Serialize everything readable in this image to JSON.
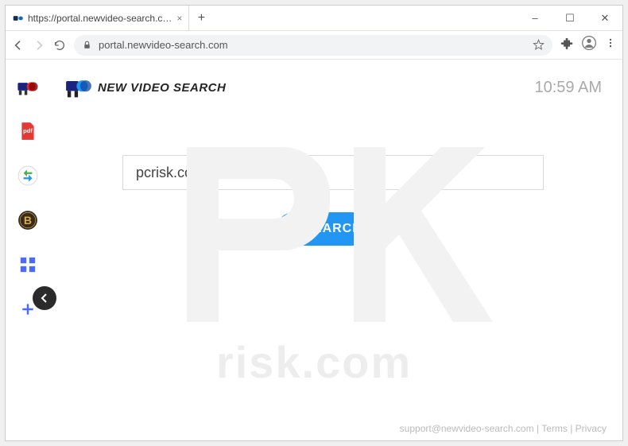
{
  "window": {
    "tab_title": "https://portal.newvideo-search.c…",
    "minimize": "–",
    "maximize": "☐",
    "close": "✕",
    "newtab": "+"
  },
  "toolbar": {
    "url": "portal.newvideo-search.com"
  },
  "header": {
    "brand": "NEW VIDEO SEARCH",
    "time": "10:59 AM"
  },
  "search": {
    "value": "pcrisk.com",
    "button": "SEARCH"
  },
  "sidebar": {
    "items": [
      {
        "name": "camera-icon"
      },
      {
        "name": "pdf-icon"
      },
      {
        "name": "swap-icon"
      },
      {
        "name": "bitcoin-icon"
      },
      {
        "name": "apps-icon"
      },
      {
        "name": "add-icon"
      }
    ],
    "collapse": "‹"
  },
  "footer": {
    "email": "support@newvideo-search.com",
    "terms": "Terms",
    "privacy": "Privacy",
    "sep": " | "
  },
  "watermark": "pcrisk.com"
}
